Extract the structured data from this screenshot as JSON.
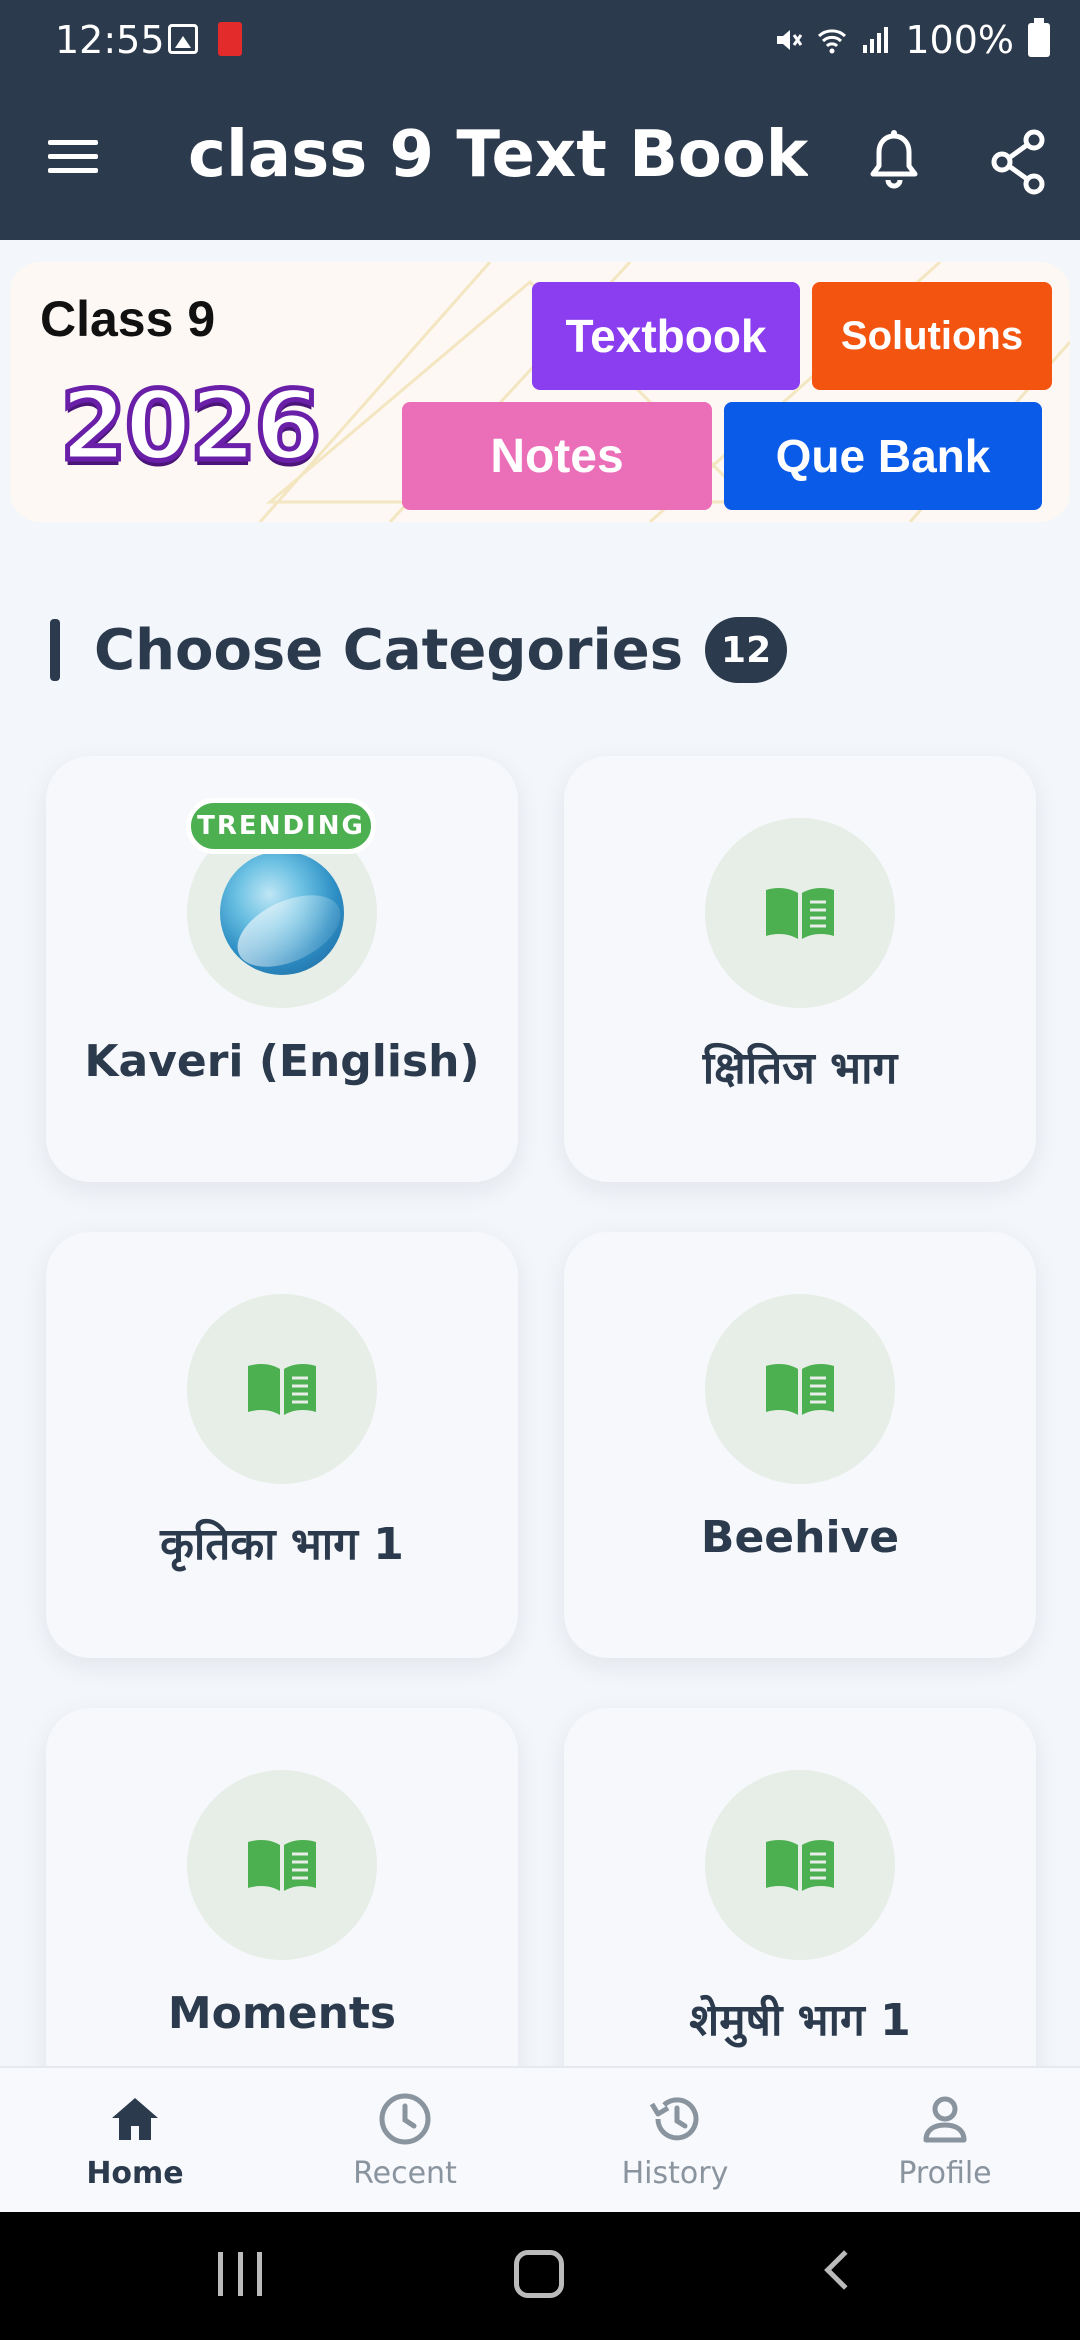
{
  "status_bar": {
    "time": "12:55",
    "battery": "100%"
  },
  "app_bar": {
    "title": "class 9 Text Book..."
  },
  "banner": {
    "class_label": "Class 9",
    "year": "2026",
    "buttons": {
      "textbook": "Textbook",
      "solutions": "Solutions",
      "notes": "Notes",
      "que_bank": "Que Bank"
    }
  },
  "section": {
    "title": "Choose Categories",
    "count": "12"
  },
  "categories": [
    {
      "name": "Kaveri (English)",
      "badge": "TRENDING",
      "icon": "book-cover-image"
    },
    {
      "name": "क्षितिज भाग",
      "icon": "book-open-icon"
    },
    {
      "name": "कृतिका भाग 1",
      "icon": "book-open-icon"
    },
    {
      "name": "Beehive",
      "icon": "book-open-icon"
    },
    {
      "name": "Moments",
      "icon": "book-open-icon"
    },
    {
      "name": "शेमुषी भाग 1",
      "icon": "book-open-icon"
    }
  ],
  "bottom_nav": {
    "items": [
      {
        "label": "Home",
        "icon": "home-icon",
        "active": true
      },
      {
        "label": "Recent",
        "icon": "clock-icon"
      },
      {
        "label": "History",
        "icon": "history-icon"
      },
      {
        "label": "Profile",
        "icon": "person-icon"
      }
    ]
  },
  "colors": {
    "primary": "#2c3a4d",
    "accent_green": "#4caf50",
    "textbook": "#8b3df0",
    "solutions": "#f35410",
    "notes": "#ea6eb8",
    "que_bank": "#0a5be8"
  }
}
